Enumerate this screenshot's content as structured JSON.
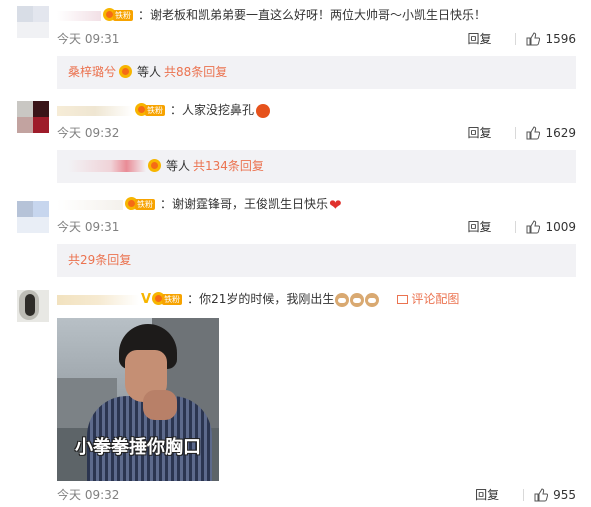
{
  "comments": [
    {
      "badge": "铁粉",
      "text": "：谢老板和凯弟弟要一直这么好呀！两位大帅哥～小凯生日快乐！",
      "time": "今天 09:31",
      "reply": "回复",
      "likes": "1596",
      "sub": {
        "user": "桑梓璐兮",
        "mid": "等人",
        "count": "共88条回复"
      }
    },
    {
      "badge": "铁粉",
      "text": "：人家没挖鼻孔",
      "emoji": "angry-face-emoji",
      "time": "今天 09:32",
      "reply": "回复",
      "likes": "1629",
      "sub": {
        "mid": "等人",
        "count": "共134条回复"
      }
    },
    {
      "badge": "铁粉",
      "text": "：谢谢霆锋哥，王俊凯生日快乐",
      "emoji": "red-heart-emoji",
      "time": "今天 09:31",
      "reply": "回复",
      "likes": "1009",
      "sub": {
        "count": "共29条回复"
      }
    },
    {
      "badge": "铁粉",
      "text": "：你21岁的时候，我刚出生",
      "emoji": "cat-emoji",
      "img_link": "评论配图",
      "image_caption": "小拳拳捶你胸口",
      "time": "今天 09:32",
      "reply": "回复",
      "likes": "955"
    }
  ],
  "colors": {
    "link": "#eb7350",
    "meta": "#808080",
    "sub_bg": "#f2f2f5"
  }
}
